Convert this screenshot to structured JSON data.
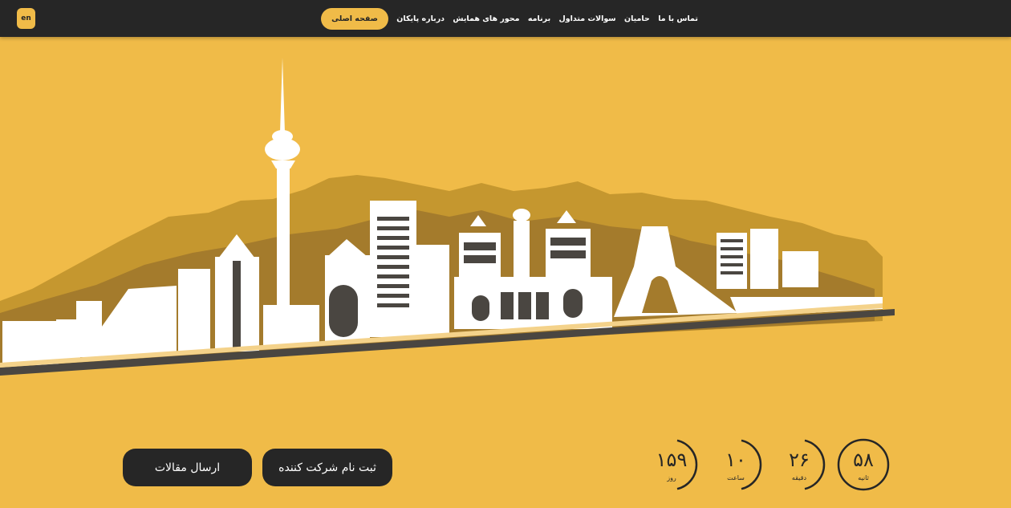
{
  "nav": {
    "lang": "en",
    "home": "صفحه اصلی",
    "items": [
      "درباره پایکان",
      "محور های همایش",
      "برنامه",
      "سوالات متداول",
      "حامیان",
      "تماس با ما"
    ]
  },
  "countdown": [
    {
      "value": "۵۸",
      "label": "ثانیه"
    },
    {
      "value": "۲۶",
      "label": "دقیقه"
    },
    {
      "value": "۱۰",
      "label": "ساعت"
    },
    {
      "value": "۱۵۹",
      "label": "روز"
    }
  ],
  "actions": {
    "register": "ثبت نام شرکت کننده",
    "submit_articles": "ارسال مقالات"
  },
  "colors": {
    "background": "#f0bb48",
    "dark": "#262626",
    "mountain_light": "#c5972f",
    "mountain_dark": "#a47b2c",
    "building": "#ffffff",
    "ground": "#4a4641"
  }
}
